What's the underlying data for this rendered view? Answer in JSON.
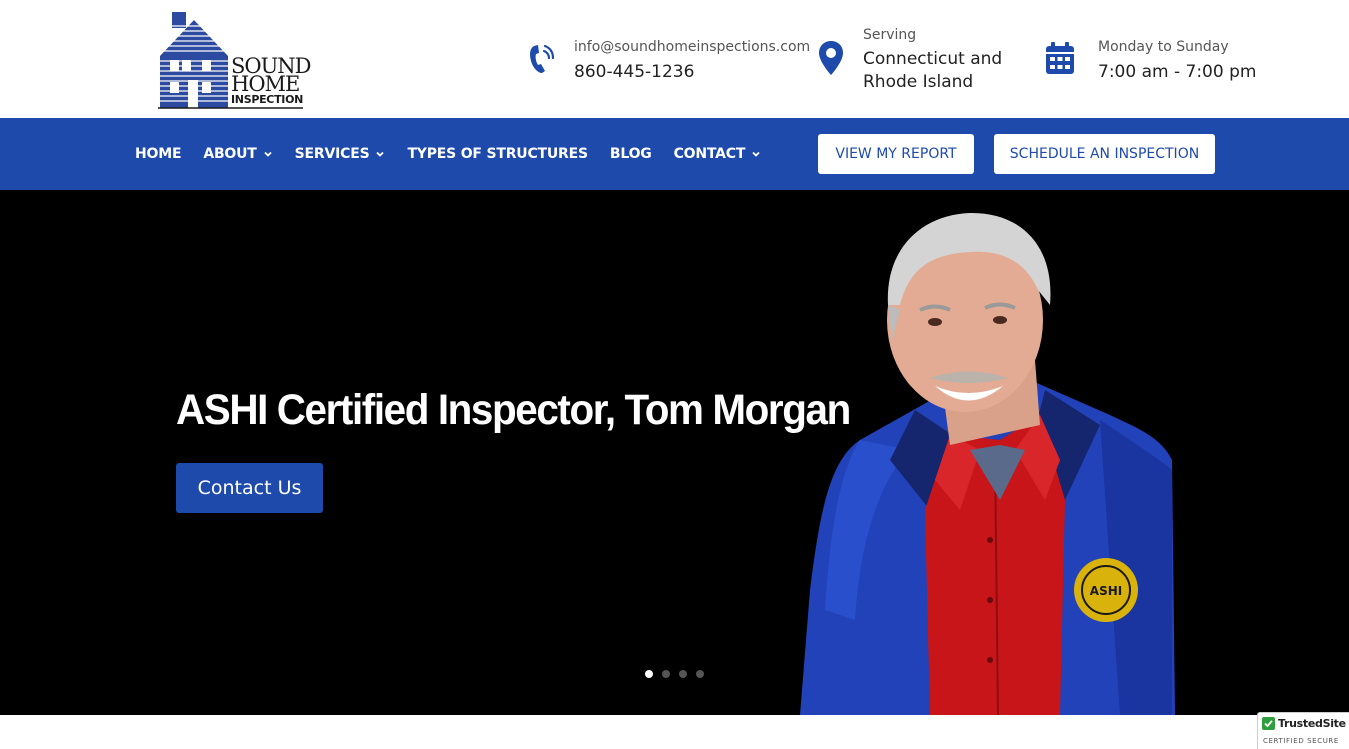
{
  "brand": {
    "logo_line1": "SOUND",
    "logo_line2": "HOME",
    "logo_line3": "INSPECTION"
  },
  "header": {
    "contact": {
      "icon": "phone-icon",
      "email": "info@soundhomeinspections.com",
      "phone": "860-445-1236"
    },
    "serving": {
      "icon": "location-pin-icon",
      "label": "Serving",
      "line1": "Connecticut and",
      "line2": "Rhode Island"
    },
    "hours": {
      "icon": "calendar-icon",
      "days": "Monday to Sunday",
      "time": "7:00 am - 7:00 pm"
    }
  },
  "nav": {
    "items": [
      {
        "label": "HOME",
        "dropdown": false
      },
      {
        "label": "ABOUT",
        "dropdown": true
      },
      {
        "label": "SERVICES",
        "dropdown": true
      },
      {
        "label": "TYPES OF STRUCTURES",
        "dropdown": false
      },
      {
        "label": "BLOG",
        "dropdown": false
      },
      {
        "label": "CONTACT",
        "dropdown": true
      }
    ],
    "report_button": "VIEW MY REPORT",
    "schedule_button": "SCHEDULE AN INSPECTION"
  },
  "hero": {
    "title": "ASHI Certified Inspector, Tom Morgan",
    "button": "Contact Us",
    "badge_text": "ASHI",
    "slides": 4,
    "active_slide": 1
  },
  "trusted_badge": {
    "title": "TrustedSite",
    "subtitle": "CERTIFIED SECURE"
  },
  "colors": {
    "brand_blue": "#1e4aac",
    "hero_bg": "#000000",
    "jacket_blue": "#2142b8",
    "shirt_red": "#c8151a"
  }
}
